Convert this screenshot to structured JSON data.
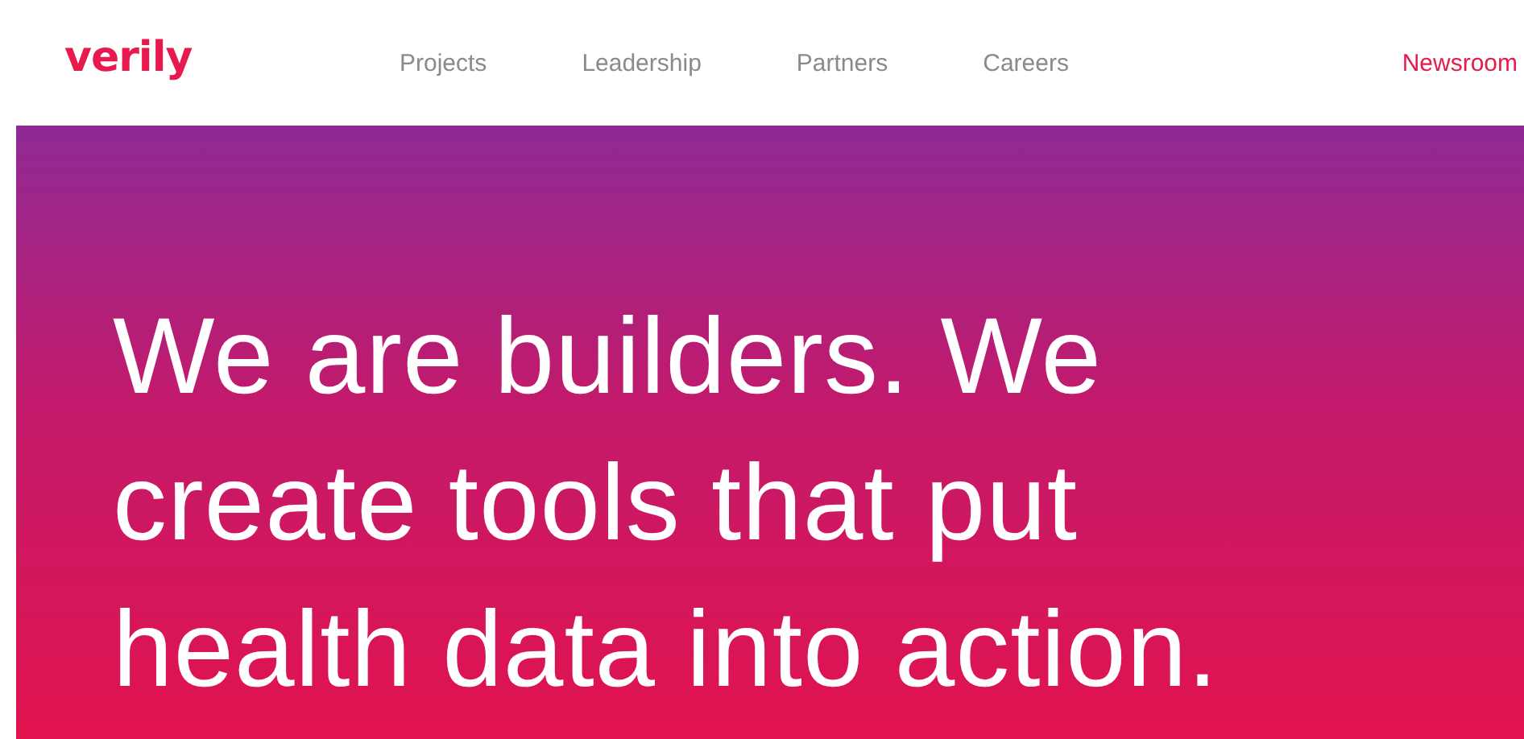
{
  "header": {
    "logo": "verily",
    "nav": [
      {
        "label": "Projects",
        "selected": false
      },
      {
        "label": "Leadership",
        "selected": false
      },
      {
        "label": "Partners",
        "selected": false
      },
      {
        "label": "Careers",
        "selected": false
      },
      {
        "label": "Newsroom",
        "selected": true
      }
    ]
  },
  "hero": {
    "headline_lines": [
      "We are builders. We",
      "create tools that put",
      "health data into action."
    ]
  }
}
